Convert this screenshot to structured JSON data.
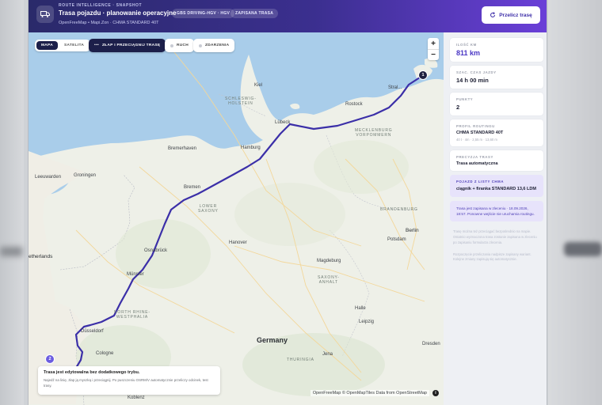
{
  "header": {
    "kicker": "ROUTE INTELLIGENCE · SNAPSHOT",
    "title": "Trasa pojazdu · planowanie operacyjne",
    "subtitle": "OpenFreeMap • Mapi.Zon · CHMA STANDARD 40T",
    "pills": [
      "GBS DRIVING-HGV · HGV",
      "ZAPISANA TRASA"
    ],
    "recalc_label": "Przelicz trasę"
  },
  "map_controls": {
    "toggle": [
      "MAPA",
      "SATELITA"
    ],
    "active_toggle": "MAPA",
    "drag_label": "ZŁAP I PRZECIĄGNIJ TRASĘ",
    "traffic_label": "RUCH",
    "events_label": "ZDARZENIA",
    "zoom_in": "+",
    "zoom_out": "−"
  },
  "map_labels": {
    "kiel": "Kiel",
    "stralsund": "Stral...",
    "rostock": "Rostock",
    "schleswig": "SCHLESWIG-\nHOLSTEIN",
    "lubeck": "Lübeck",
    "mecklenburg": "MECKLENBURG\nVORPOMMERN",
    "hamburg": "Hamburg",
    "bremerhaven": "Bremerhaven",
    "leeuwarden": "Leeuwarden",
    "groningen": "Groningen",
    "bremen": "Bremen",
    "lower_saxony": "LOWER\nSAXONY",
    "brandenburg": "BRANDENBURG",
    "berlin": "Berlin",
    "potsdam": "Potsdam",
    "netherlands": "etherlands",
    "osnabruck": "Osnabrück",
    "hanover": "Hanover",
    "magdeburg": "Magdeburg",
    "saxony_anhalt": "SAXONY-\nANHALT",
    "munster": "Münster",
    "nrw": "NORTH RHINE-\nWESTPHALIA",
    "halle": "Halle",
    "leipzig": "Leipzig",
    "dusseldorf": "Düsseldorf",
    "germany": "Germany",
    "cologne": "Cologne",
    "jena": "Jena",
    "dresden": "Dresden",
    "thuringia": "THURINGIA",
    "koblenz": "Koblenz"
  },
  "pins": {
    "start": "1",
    "end": "2"
  },
  "notice": {
    "title": "Trasa jest edytowalna bez dodatkowego trybu.",
    "body": "Najedź na linię, złap ją myszką i przeciągnij. Po puszczeniu OSRM/V automatycznie przeliczy odcinek, test trasy."
  },
  "attribution": "OpenFreeMap © OpenMapTiles Data from OpenStreetMap",
  "sidebar": {
    "distance_key": "ILOŚĆ KM",
    "distance_val": "811 km",
    "time_key": "SZAC. CZAS JAZDY",
    "time_val": "14 h 00 min",
    "points_key": "PUNKTY",
    "points_val": "2",
    "profile_key": "PROFIL ROUTINGU",
    "profile_val": "CHMA STANDARD 40T",
    "profile_sub": "40 t · 4m · 2,55 m · 13,60 m",
    "precision_key": "PRECYZJA TRASY",
    "precision_val": "Trasa automatyczna",
    "vehicle_key": "POJAZD Z LISTY CHMA",
    "vehicle_val": "ciągnik + firanka STANDARD 13,6 LDM",
    "saved_note": "Trasa jest zapisana w zleceniu · 18.09.2026, 18:57. Ponowne wejście nie uruchamia routingu.",
    "faded_1": "Trasę można też przeciągać bezpośrednio na mapie. Ostatnio wyznaczona trasa zostanie zapisana w zleceniu po zapisaniu formularza zlecenia.",
    "faded_2": "Rozpoczęcie przeliczania nadpisze zapisany wariant. Kolejne zmiany zapisują się automatycznie."
  },
  "colors": {
    "accent": "#4936c4",
    "route": "#3b2fa8",
    "header_start": "#2a2a6a",
    "header_end": "#6a3fd8",
    "sea": "#a9cdea",
    "land": "#eef0e8"
  }
}
